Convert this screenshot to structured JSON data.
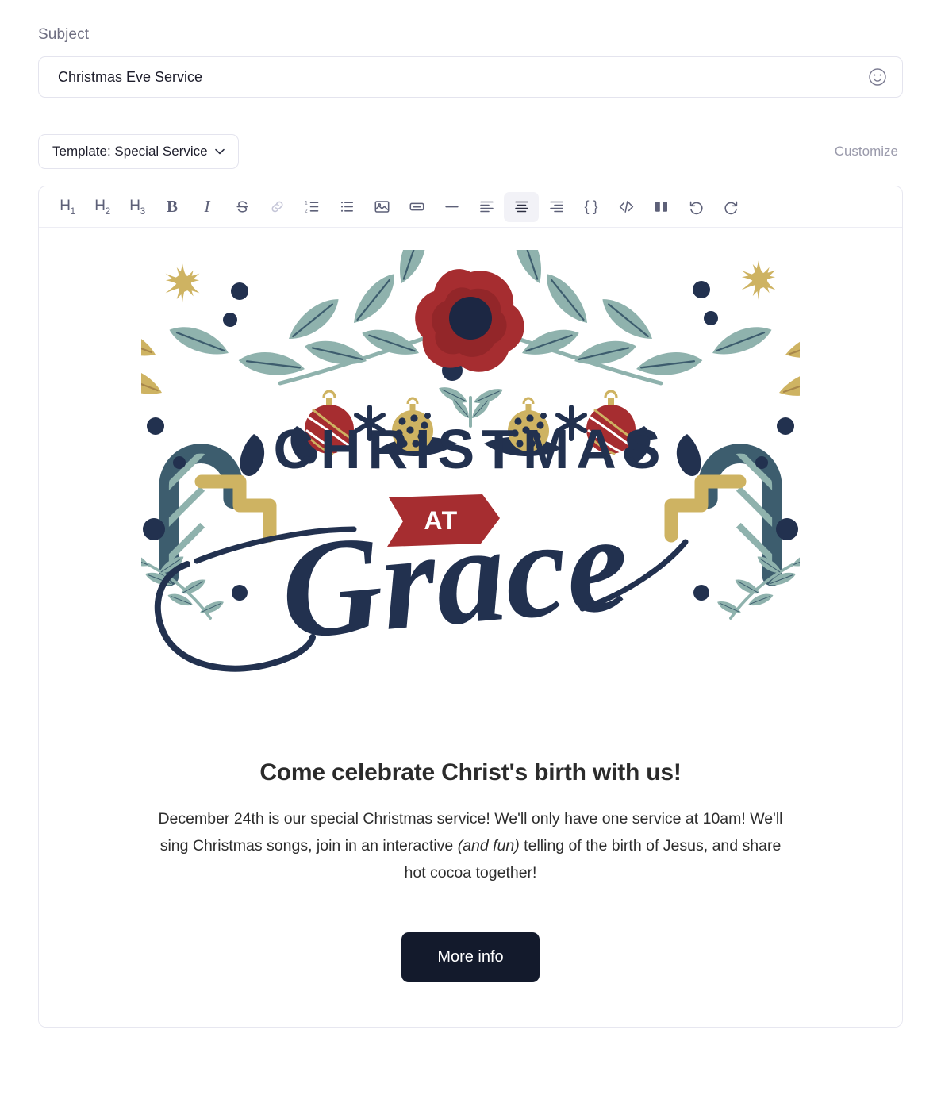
{
  "subject": {
    "label": "Subject",
    "value": "Christmas Eve Service",
    "placeholder": "Subject",
    "emoji_icon": "smiley-face-icon"
  },
  "template_bar": {
    "select_label": "Template: Special Service",
    "chevron_icon": "chevron-down-icon",
    "customize_label": "Customize"
  },
  "toolbar": {
    "items": [
      {
        "name": "heading-1-button",
        "glyph": "H",
        "sub": "1",
        "kind": "heading",
        "state": "default"
      },
      {
        "name": "heading-2-button",
        "glyph": "H",
        "sub": "2",
        "kind": "heading",
        "state": "default"
      },
      {
        "name": "heading-3-button",
        "glyph": "H",
        "sub": "3",
        "kind": "heading",
        "state": "default"
      },
      {
        "name": "bold-button",
        "glyph": "B",
        "kind": "text-bold",
        "state": "default"
      },
      {
        "name": "italic-button",
        "glyph": "I",
        "kind": "text-italic",
        "state": "default"
      },
      {
        "name": "strikethrough-button",
        "glyph": "S",
        "kind": "icon-strike",
        "state": "default"
      },
      {
        "name": "link-button",
        "glyph": "",
        "kind": "icon-link",
        "state": "disabled"
      },
      {
        "name": "ordered-list-button",
        "glyph": "",
        "kind": "icon-ol",
        "state": "default"
      },
      {
        "name": "bulleted-list-button",
        "glyph": "",
        "kind": "icon-ul",
        "state": "default"
      },
      {
        "name": "insert-image-button",
        "glyph": "",
        "kind": "icon-image",
        "state": "default"
      },
      {
        "name": "insert-button-button",
        "glyph": "",
        "kind": "icon-button",
        "state": "default"
      },
      {
        "name": "horizontal-rule-button",
        "glyph": "",
        "kind": "icon-hr",
        "state": "default"
      },
      {
        "name": "align-left-button",
        "glyph": "",
        "kind": "icon-align-left",
        "state": "default"
      },
      {
        "name": "align-center-button",
        "glyph": "",
        "kind": "icon-align-center",
        "state": "active"
      },
      {
        "name": "align-right-button",
        "glyph": "",
        "kind": "icon-align-right",
        "state": "default"
      },
      {
        "name": "merge-field-button",
        "glyph": "{ }",
        "kind": "text-plain",
        "state": "default"
      },
      {
        "name": "source-code-button",
        "glyph": "",
        "kind": "icon-code",
        "state": "default"
      },
      {
        "name": "columns-button",
        "glyph": "",
        "kind": "icon-columns",
        "state": "default"
      },
      {
        "name": "undo-button",
        "glyph": "",
        "kind": "icon-undo",
        "state": "default"
      },
      {
        "name": "redo-button",
        "glyph": "",
        "kind": "icon-redo",
        "state": "default"
      }
    ]
  },
  "email": {
    "hero": {
      "title_line": "CHRISTMAS",
      "banner_text": "AT",
      "script_text": "Grace"
    },
    "headline": "Come celebrate Christ's birth with us!",
    "paragraph_part1": "December 24th is our special Christmas service! We'll only have one service at 10am! We'll sing Christmas songs, join in an interactive ",
    "paragraph_italic": "(and fun)",
    "paragraph_part2": " telling of the birth of Jesus, and share hot cocoa together!",
    "cta_label": "More info"
  },
  "colors": {
    "navy": "#22314f",
    "navy_dark": "#1c2743",
    "red": "#a62d30",
    "gold": "#ceb362",
    "sage": "#8fb2ad",
    "teal": "#3d5d6e",
    "button_bg": "#131a2c"
  }
}
